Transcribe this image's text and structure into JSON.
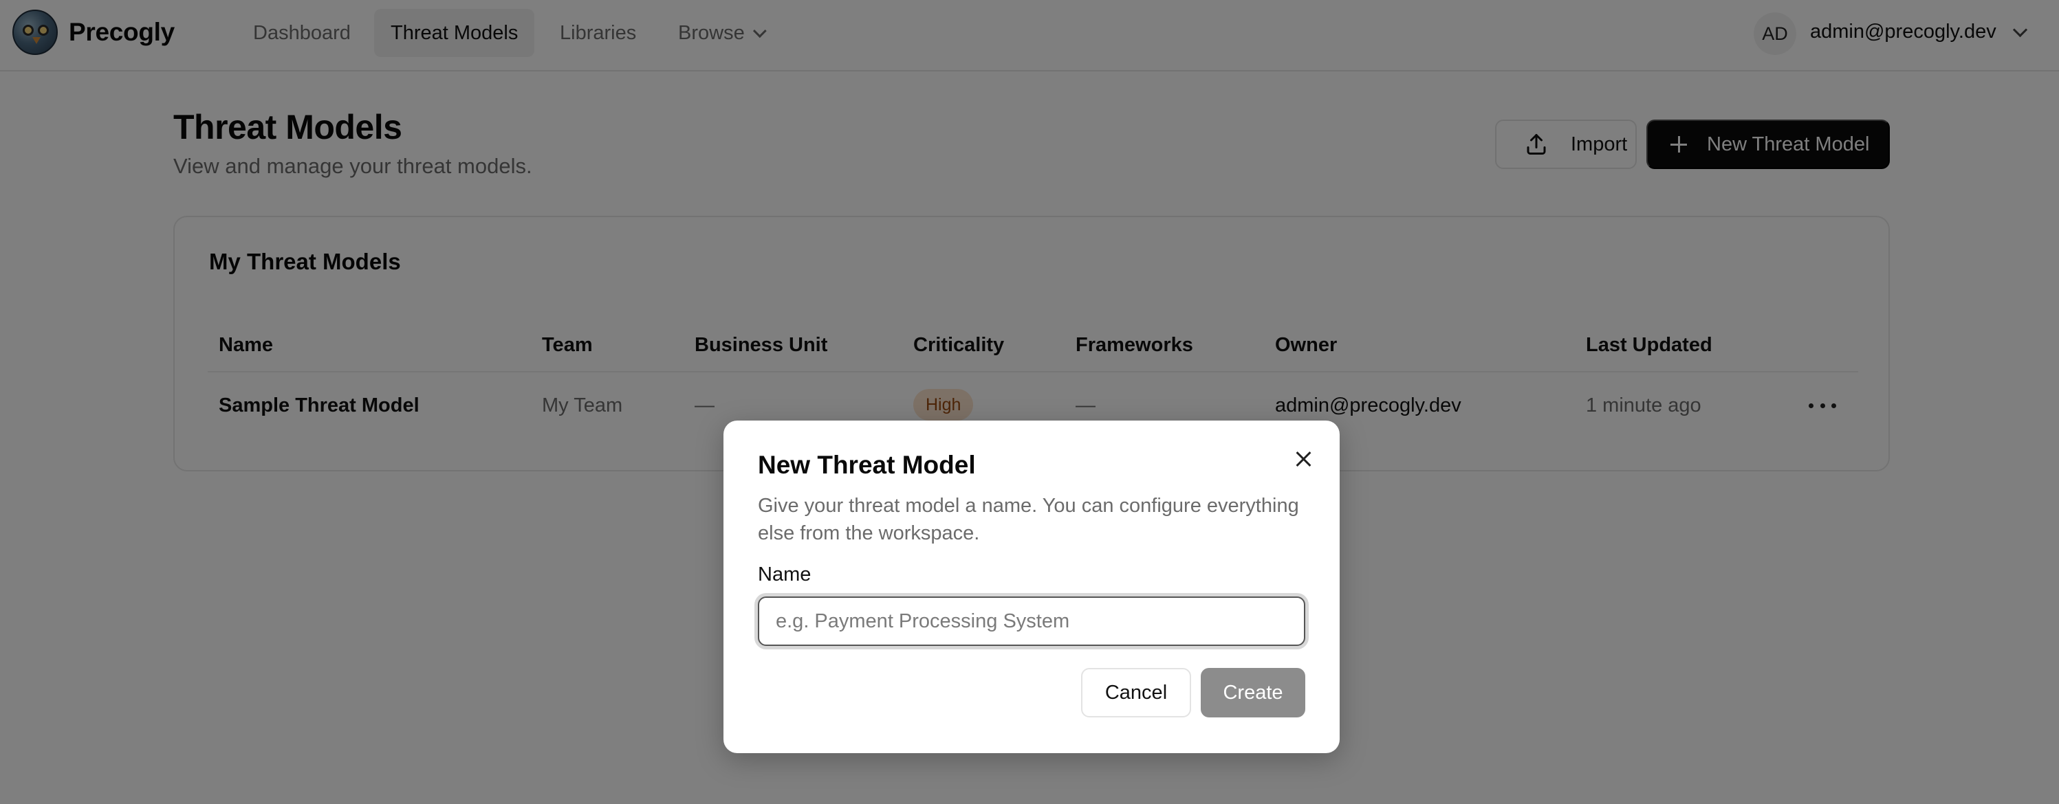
{
  "app": {
    "name": "Precogly"
  },
  "nav": {
    "items": [
      {
        "label": "Dashboard"
      },
      {
        "label": "Threat Models"
      },
      {
        "label": "Libraries"
      },
      {
        "label": "Browse"
      }
    ],
    "active": "Threat Models"
  },
  "user": {
    "initials": "AD",
    "email": "admin@precogly.dev"
  },
  "page": {
    "title": "Threat Models",
    "subtitle": "View and manage your threat models.",
    "import_label": "Import",
    "new_label": "New Threat Model"
  },
  "card": {
    "title": "My Threat Models",
    "columns": [
      "Name",
      "Team",
      "Business Unit",
      "Criticality",
      "Frameworks",
      "Owner",
      "Last Updated"
    ],
    "rows": [
      {
        "name": "Sample Threat Model",
        "team": "My Team",
        "business_unit": "—",
        "criticality": "High",
        "frameworks": "—",
        "owner": "admin@precogly.dev",
        "last_updated": "1 minute ago"
      }
    ]
  },
  "dialog": {
    "title": "New Threat Model",
    "description": "Give your threat model a name. You can configure everything else from the workspace.",
    "name_label": "Name",
    "name_value": "",
    "name_placeholder": "e.g. Payment Processing System",
    "cancel_label": "Cancel",
    "create_label": "Create"
  },
  "colors": {
    "primary": "#0b0b0b",
    "badge_high_bg": "#fbe3cc",
    "badge_high_text": "#9a4a10",
    "overlay": "rgba(0,0,0,0.5)"
  }
}
